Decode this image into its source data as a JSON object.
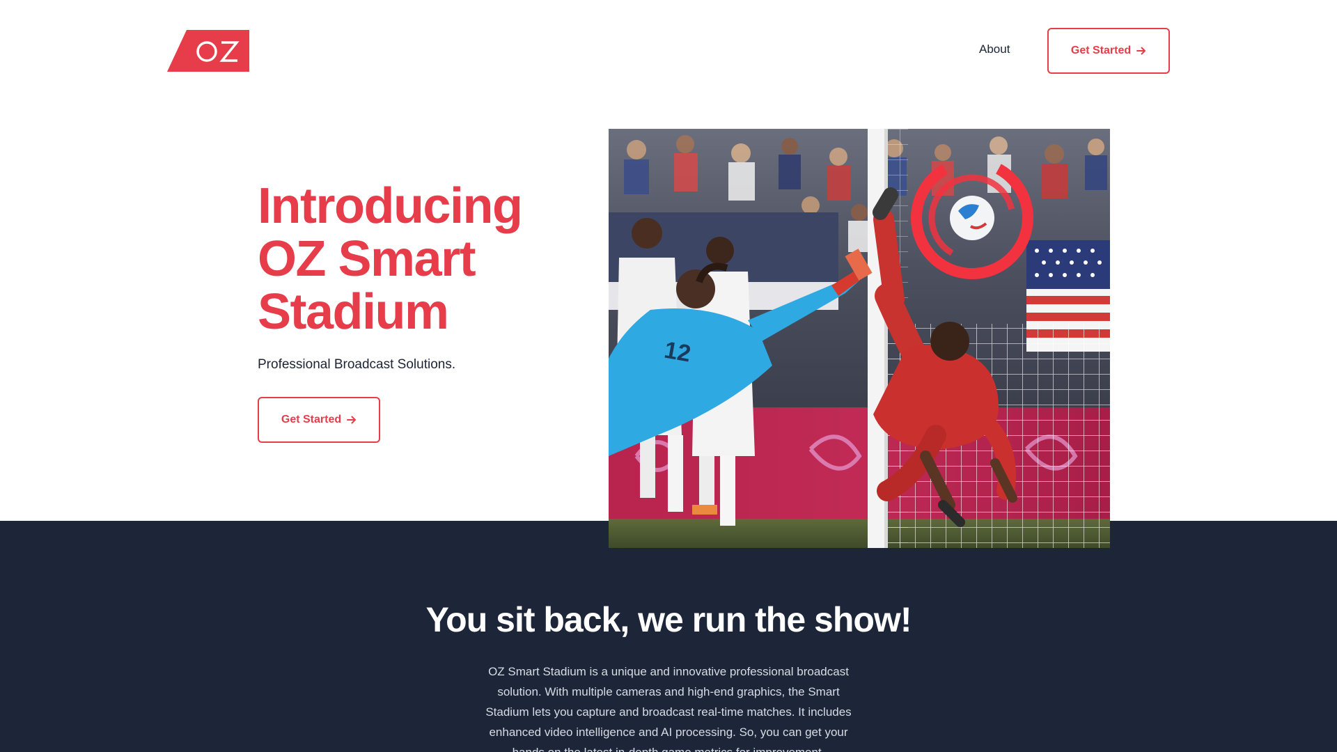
{
  "header": {
    "logo_text": "OZ",
    "nav_about": "About",
    "cta_label": "Get Started"
  },
  "hero": {
    "title_line1": "Introducing",
    "title_line2": "OZ Smart",
    "title_line3": "Stadium",
    "subtitle": "Professional Broadcast Solutions.",
    "cta_label": "Get Started",
    "image_jersey_number": "12"
  },
  "section": {
    "heading": "You sit back, we run the show!",
    "body": "OZ Smart Stadium is a unique and innovative professional broadcast solution.  With multiple cameras and high-end graphics, the Smart Stadium lets you capture and broadcast real-time matches. It includes enhanced video intelligence and AI processing. So, you can get your hands on the latest in-depth game metrics for improvement."
  },
  "colors": {
    "brand_red": "#e73c4a",
    "navy": "#1d2639",
    "text_dark": "#1c2434"
  },
  "icons": {
    "cta_arrow": "arrow-right-icon"
  }
}
